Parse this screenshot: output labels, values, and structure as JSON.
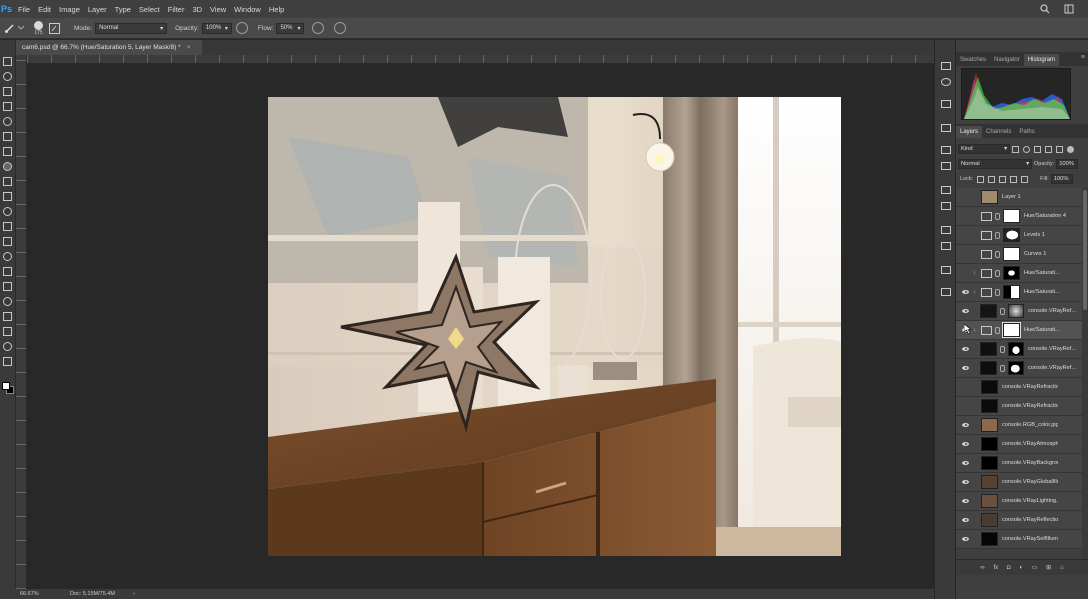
{
  "app": {
    "logo": "Ps",
    "menu": [
      "File",
      "Edit",
      "Image",
      "Layer",
      "Type",
      "Select",
      "Filter",
      "3D",
      "View",
      "Window",
      "Help"
    ]
  },
  "options": {
    "brush_size": "175",
    "mode_label": "Mode:",
    "mode_value": "Normal",
    "opacity_label": "Opacity:",
    "opacity_value": "100%",
    "flow_label": "Flow:",
    "flow_value": "50%"
  },
  "document": {
    "tab_title": "cam6.psd @ 66.7% (Hue/Saturation 5, Layer Mask/8) *",
    "tab_close": "×"
  },
  "status": {
    "zoom": "66.67%",
    "doc_info": "Doc: 5.15M/75.4M",
    "arrow": "›"
  },
  "panels": {
    "top_tabs": [
      "Swatches",
      "Navigator",
      "Histogram"
    ],
    "top_active": 2,
    "layer_tabs": [
      "Layers",
      "Channels",
      "Paths"
    ],
    "layer_active": 0,
    "filter_kind": "Kind",
    "blend_mode": "Normal",
    "opacity_label": "Opacity:",
    "opacity_value": "100%",
    "lock_label": "Lock:",
    "fill_label": "Fill:",
    "fill_value": "100%"
  },
  "layers": [
    {
      "name": "Layer 1",
      "visible": false,
      "kind": "pixel",
      "thumb": "#a08a70",
      "mask": null,
      "clip": false,
      "selected": false
    },
    {
      "name": "Hue/Saturation 4",
      "visible": false,
      "kind": "adj",
      "mask": "white",
      "clip": false,
      "selected": false
    },
    {
      "name": "Levels 1",
      "visible": false,
      "kind": "adj",
      "mask": "white-blob",
      "clip": false,
      "selected": false
    },
    {
      "name": "Curves 1",
      "visible": false,
      "kind": "adj",
      "mask": "white",
      "clip": false,
      "selected": false
    },
    {
      "name": "Hue/Saturati...",
      "visible": false,
      "kind": "adj",
      "mask": "black-white",
      "clip": true,
      "selected": false
    },
    {
      "name": "Hue/Saturati...",
      "visible": true,
      "kind": "adj",
      "mask": "black-white2",
      "clip": true,
      "selected": false
    },
    {
      "name": "console.VRayRef...",
      "visible": true,
      "kind": "pixel",
      "thumb": "#151515",
      "mask": "gray",
      "clip": false,
      "selected": false
    },
    {
      "name": "Hue/Saturati...",
      "visible": true,
      "kind": "adj",
      "mask": "white",
      "clip": true,
      "selected": true
    },
    {
      "name": "console.VRayRef...",
      "visible": true,
      "kind": "pixel",
      "thumb": "#101010",
      "mask": "black-white3",
      "clip": false,
      "selected": false
    },
    {
      "name": "console.VRayRef...",
      "visible": true,
      "kind": "pixel",
      "thumb": "#0d0d0d",
      "mask": "black-blob",
      "clip": false,
      "selected": false
    },
    {
      "name": "console.VRayRefraction.jpg",
      "visible": false,
      "kind": "pixel",
      "thumb": "#0b0b0b",
      "mask": null,
      "clip": false,
      "selected": false
    },
    {
      "name": "console.VRayRefraction.jpg",
      "visible": false,
      "kind": "pixel",
      "thumb": "#0b0b0b",
      "mask": null,
      "clip": false,
      "selected": false
    },
    {
      "name": "console.RGB_color.jpg",
      "visible": true,
      "kind": "pixel",
      "thumb": "#8a6a4e",
      "mask": null,
      "clip": false,
      "selected": false
    },
    {
      "name": "console.VRayAtmosphere.jpg",
      "visible": true,
      "kind": "pixel",
      "thumb": "#000000",
      "mask": null,
      "clip": false,
      "selected": false
    },
    {
      "name": "console.VRayBackground.jpg",
      "visible": true,
      "kind": "pixel",
      "thumb": "#000000",
      "mask": null,
      "clip": false,
      "selected": false
    },
    {
      "name": "console.VRayGlobalIllumina...",
      "visible": true,
      "kind": "pixel",
      "thumb": "#5a4030",
      "mask": null,
      "clip": false,
      "selected": false
    },
    {
      "name": "console.VRayLighting.jpg",
      "visible": true,
      "kind": "pixel",
      "thumb": "#6a5040",
      "mask": null,
      "clip": false,
      "selected": false
    },
    {
      "name": "console.VRayReflection.jpg",
      "visible": true,
      "kind": "pixel",
      "thumb": "#4a3a30",
      "mask": null,
      "clip": false,
      "selected": false
    },
    {
      "name": "console.VRaySelfIllumination...",
      "visible": true,
      "kind": "pixel",
      "thumb": "#050505",
      "mask": null,
      "clip": false,
      "selected": false
    }
  ],
  "footer_icons": [
    "link-icon",
    "fx-icon",
    "mask-icon",
    "adjustment-icon",
    "folder-icon",
    "new-layer-icon",
    "trash-icon"
  ],
  "footer_fx": "fx"
}
